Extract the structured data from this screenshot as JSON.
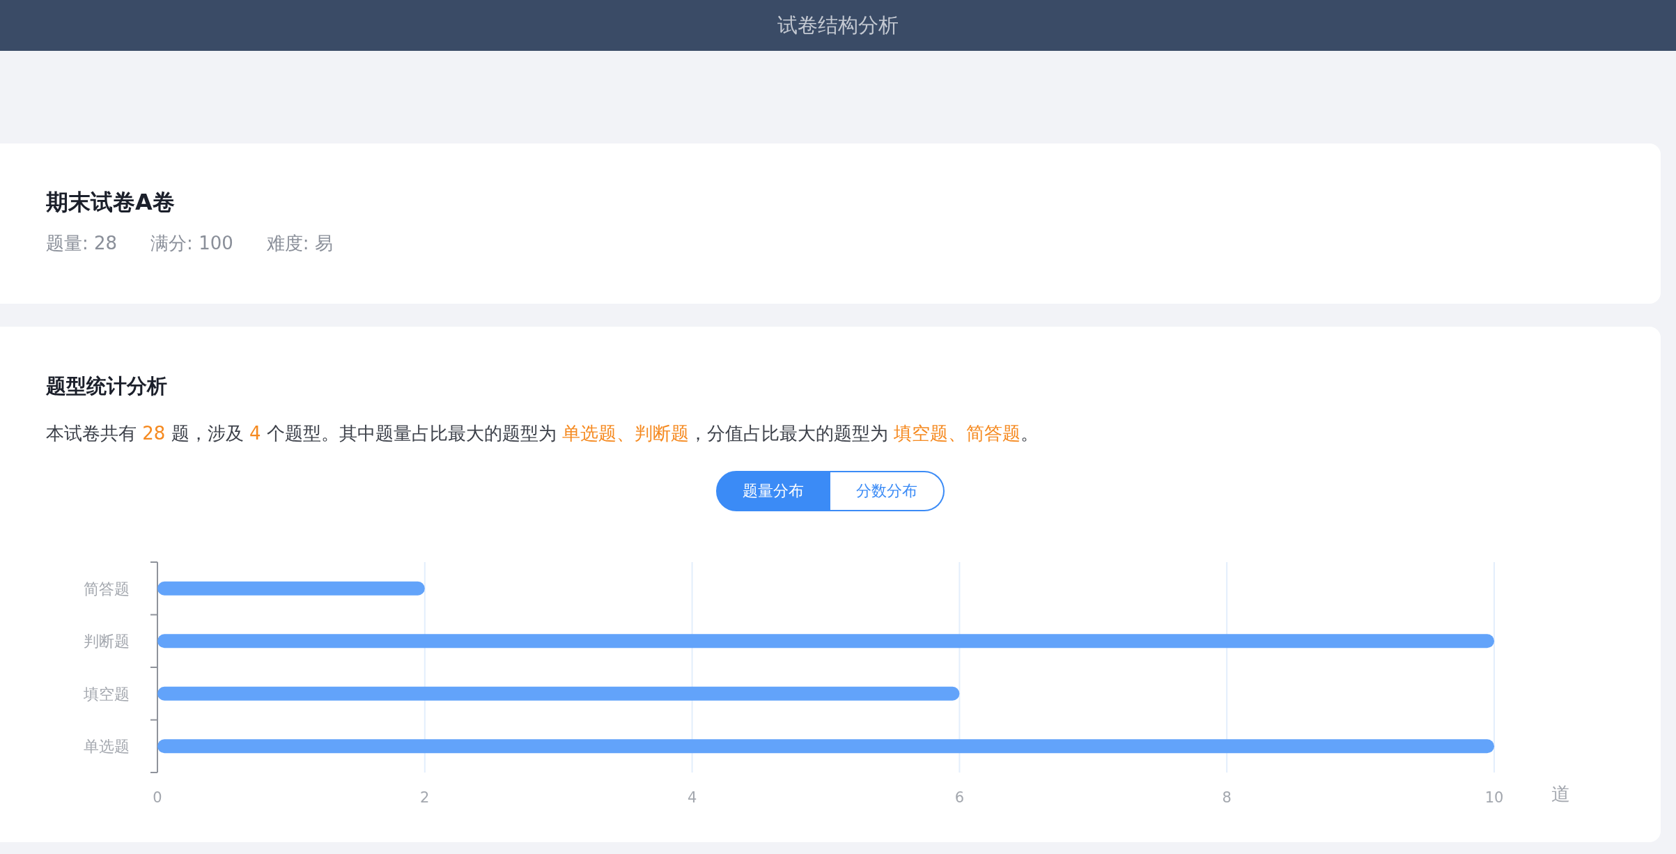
{
  "header": {
    "title": "试卷结构分析"
  },
  "paper": {
    "title": "期末试卷A卷",
    "meta": [
      {
        "label": "题量:",
        "value": "28"
      },
      {
        "label": "满分:",
        "value": "100"
      },
      {
        "label": "难度:",
        "value": "易"
      }
    ]
  },
  "analysis": {
    "title": "题型统计分析",
    "summary": [
      {
        "text": "本试卷共有 ",
        "highlight": false
      },
      {
        "text": "28",
        "highlight": true
      },
      {
        "text": " 题，涉及 ",
        "highlight": false
      },
      {
        "text": "4",
        "highlight": true
      },
      {
        "text": " 个题型。其中题量占比最大的题型为 ",
        "highlight": false
      },
      {
        "text": "单选题、判断题",
        "highlight": true
      },
      {
        "text": "，分值占比最大的题型为 ",
        "highlight": false
      },
      {
        "text": "填空题、简答题",
        "highlight": true
      },
      {
        "text": "。",
        "highlight": false
      }
    ],
    "toggle": [
      {
        "label": "题量分布",
        "selected": true
      },
      {
        "label": "分数分布",
        "selected": false
      }
    ],
    "chart_data": {
      "type": "bar",
      "orientation": "horizontal",
      "xlabel": "道",
      "categories": [
        "简答题",
        "判断题",
        "填空题",
        "单选题"
      ],
      "series": [
        {
          "color": "#62a3fa",
          "values": [
            2,
            10,
            6,
            10
          ]
        }
      ],
      "xlim": [
        0,
        10
      ],
      "xticks": [
        0,
        2,
        4,
        6,
        8,
        10
      ],
      "grid": true
    }
  }
}
